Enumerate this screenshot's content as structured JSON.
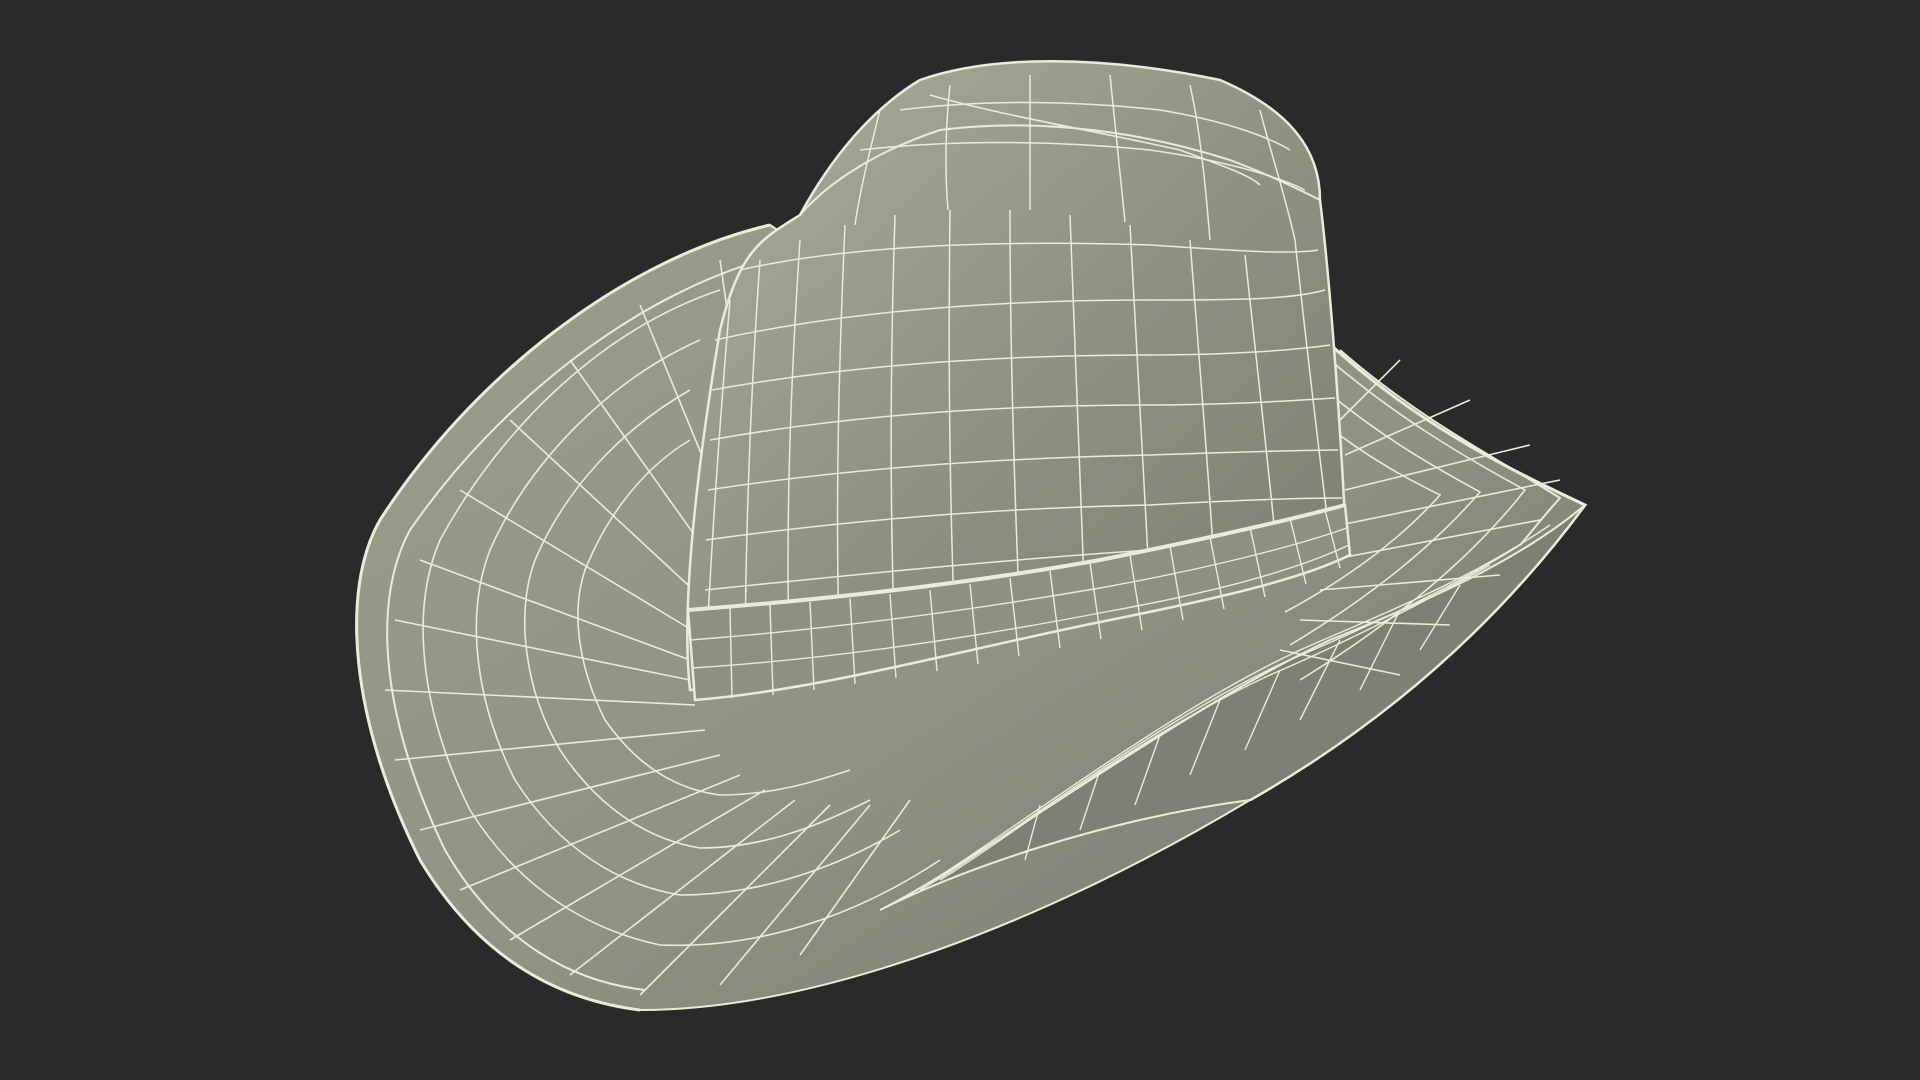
{
  "scene": {
    "subject": "hat-wireframe",
    "background_color": "#2a2a2a",
    "surface_color": "#8f9384",
    "surface_highlight": "#a9ad9c",
    "surface_shadow": "#6f7265",
    "wire_color": "#ecebd8",
    "band_color": "#8d9182"
  }
}
